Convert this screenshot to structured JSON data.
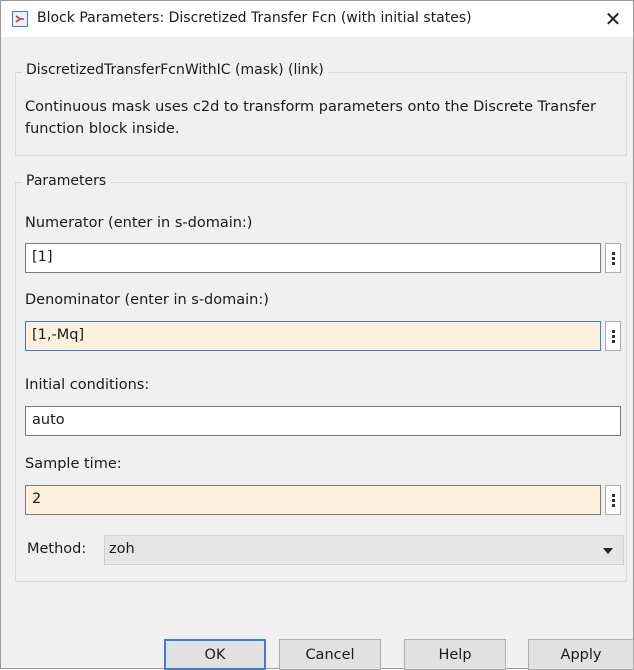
{
  "window": {
    "title": "Block Parameters: Discretized Transfer Fcn (with initial states)",
    "close_glyph": "✕"
  },
  "mask": {
    "legend": "DiscretizedTransferFcnWithIC (mask) (link)",
    "description": "Continuous mask uses c2d to transform parameters onto the Discrete Transfer function block inside."
  },
  "parameters": {
    "legend": "Parameters",
    "numerator": {
      "label": "Numerator (enter in s-domain:)",
      "value": "[1]"
    },
    "denominator": {
      "label": "Denominator (enter in s-domain:)",
      "value": "[1,-Mq]"
    },
    "initial_conditions": {
      "label": "Initial conditions:",
      "value": "auto"
    },
    "sample_time": {
      "label": "Sample time:",
      "value": "2"
    },
    "method": {
      "label": "Method:",
      "value": "zoh"
    }
  },
  "buttons": {
    "ok": "OK",
    "cancel": "Cancel",
    "help": "Help",
    "apply": "Apply"
  },
  "colors": {
    "tinted_field": "#fdf0dd",
    "focus_border": "#3c7fd1",
    "dialog_bg": "#f0f0f0"
  }
}
